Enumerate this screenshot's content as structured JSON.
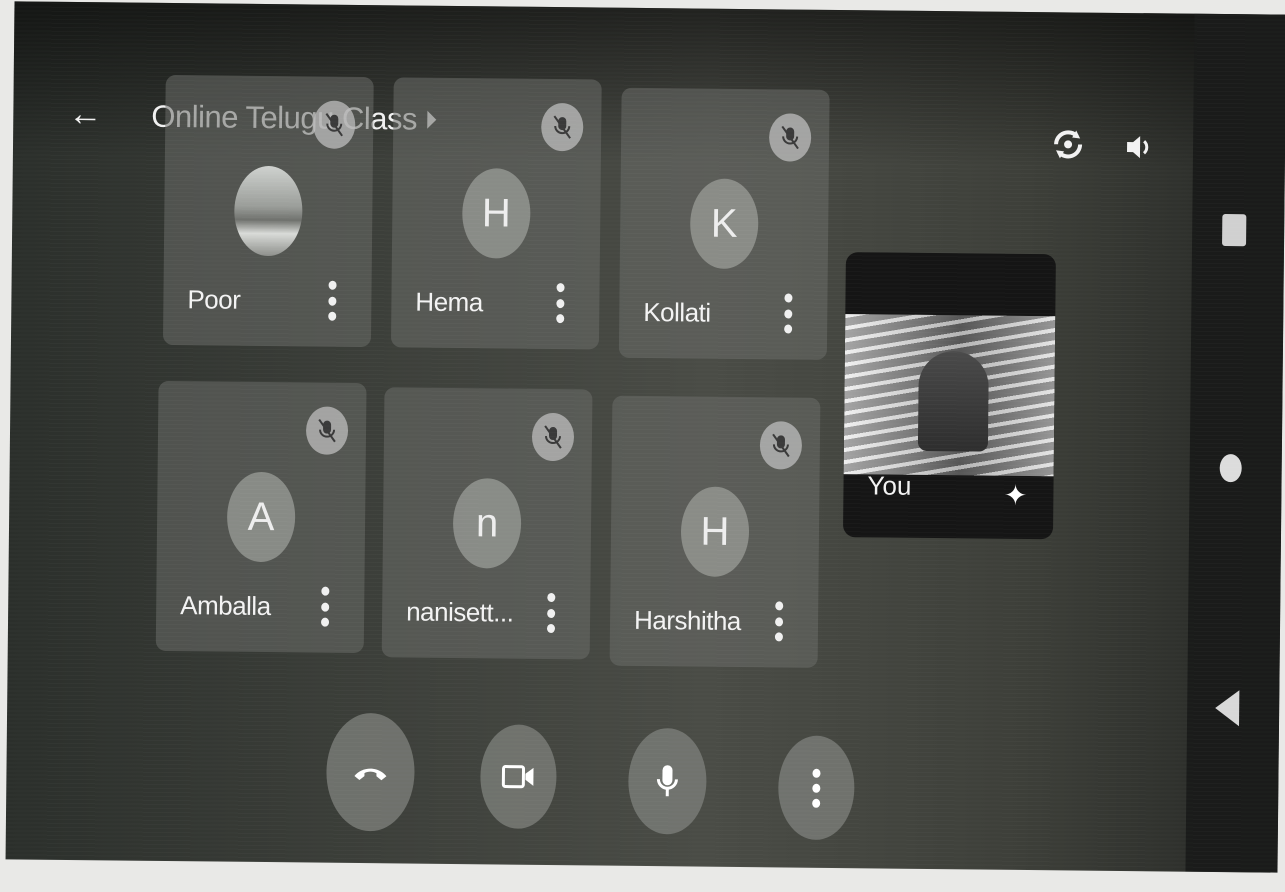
{
  "header": {
    "back_icon": "arrow-left-icon",
    "title": "Online Telugu Class",
    "title_chevron_icon": "chevron-right-icon",
    "switch_camera_icon": "switch-camera-icon",
    "speaker_icon": "speaker-icon"
  },
  "participants": [
    {
      "name": "Poor",
      "initial": "",
      "avatar_type": "photo",
      "muted": true
    },
    {
      "name": "Hema",
      "initial": "H",
      "avatar_type": "letter",
      "muted": true
    },
    {
      "name": "Kollati",
      "initial": "K",
      "avatar_type": "letter",
      "muted": true
    },
    {
      "name": "Amballa",
      "initial": "A",
      "avatar_type": "letter",
      "muted": true
    },
    {
      "name": "nanisett...",
      "initial": "n",
      "avatar_type": "letter",
      "muted": true
    },
    {
      "name": "Harshitha",
      "initial": "H",
      "avatar_type": "letter",
      "muted": true
    }
  ],
  "self_view": {
    "label": "You",
    "effects_icon": "sparkle-icon"
  },
  "controls": {
    "end_call_icon": "hang-up-icon",
    "camera_icon": "video-camera-icon",
    "mic_icon": "microphone-icon",
    "more_icon": "more-vertical-icon"
  },
  "system_nav": {
    "recents_icon": "square-icon",
    "home_icon": "circle-icon",
    "back_icon": "triangle-back-icon"
  },
  "colors": {
    "tile_bg": "#696c68",
    "control_bg": "#787a76",
    "text": "#f3f3f3"
  }
}
